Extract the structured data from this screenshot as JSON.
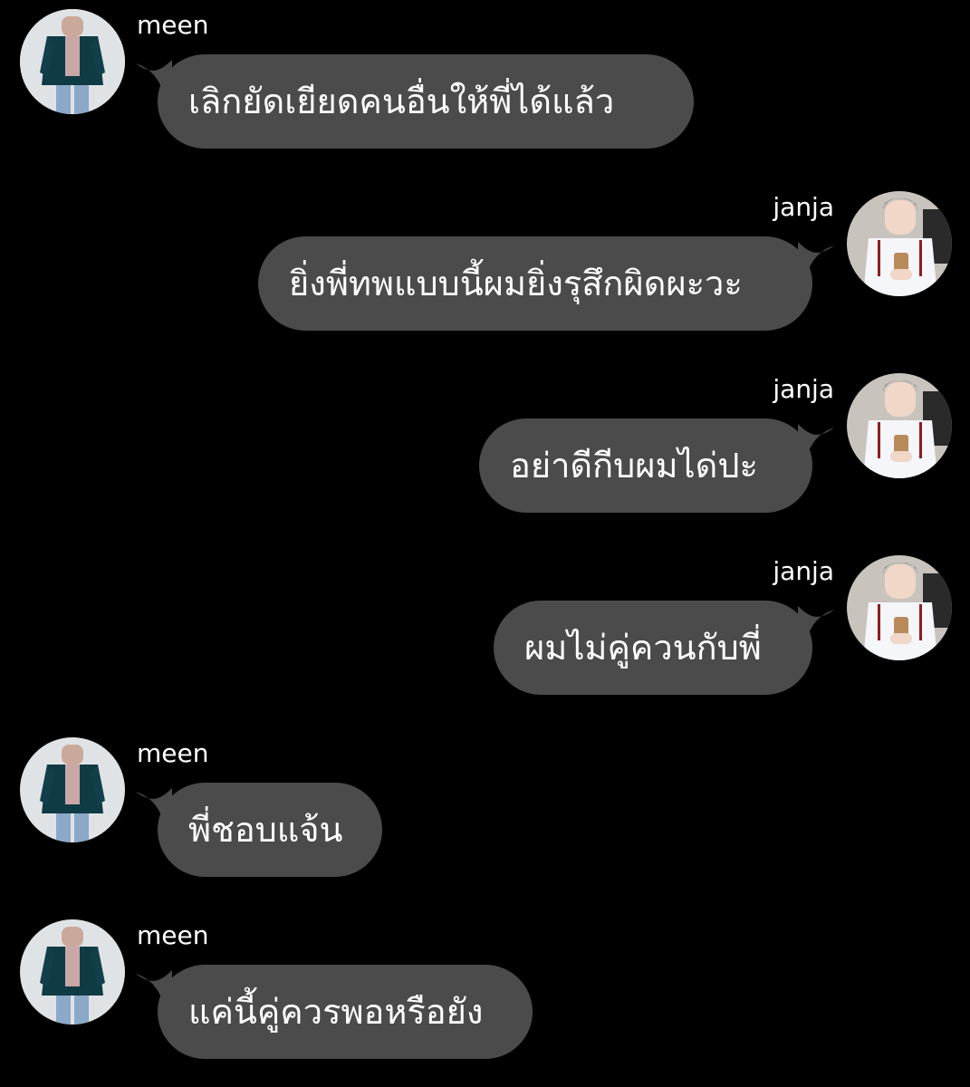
{
  "colors": {
    "background": "#000000",
    "bubble": "#4b4b4b",
    "text": "#ffffff"
  },
  "messages": [
    {
      "sender": "meen",
      "direction": "incoming",
      "text": "เลิกยัดเยียดคนอื่นให้พี่ได้แล้ว",
      "avatar": "meen-avatar"
    },
    {
      "sender": "janja",
      "direction": "outgoing",
      "text": "ยิ่งพี่ทพแบบนี้ผมยิ่งรุสึกผิดผะวะ",
      "avatar": "janja-avatar"
    },
    {
      "sender": "janja",
      "direction": "outgoing",
      "text": "อย่าดีกีบผมได่ปะ",
      "avatar": "janja-avatar"
    },
    {
      "sender": "janja",
      "direction": "outgoing",
      "text": "ผมไม่คู่ควนกับพี่",
      "avatar": "janja-avatar"
    },
    {
      "sender": "meen",
      "direction": "incoming",
      "text": "พี่ชอบแจ้น",
      "avatar": "meen-avatar"
    },
    {
      "sender": "meen",
      "direction": "incoming",
      "text": "แค่นี้คู่ควรพอหรือยัง",
      "avatar": "meen-avatar"
    }
  ]
}
